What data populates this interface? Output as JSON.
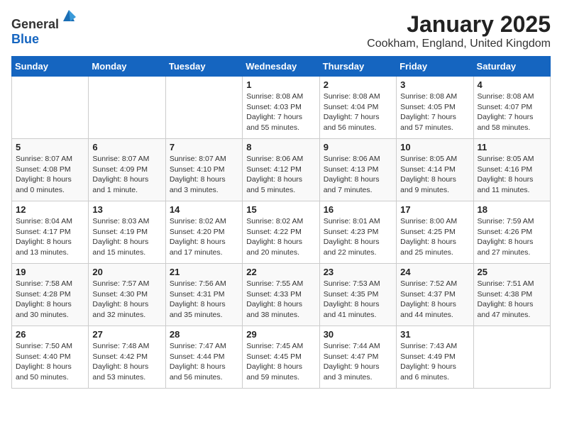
{
  "header": {
    "logo_general": "General",
    "logo_blue": "Blue",
    "title": "January 2025",
    "location": "Cookham, England, United Kingdom"
  },
  "days_of_week": [
    "Sunday",
    "Monday",
    "Tuesday",
    "Wednesday",
    "Thursday",
    "Friday",
    "Saturday"
  ],
  "weeks": [
    [
      {
        "day": "",
        "info": ""
      },
      {
        "day": "",
        "info": ""
      },
      {
        "day": "",
        "info": ""
      },
      {
        "day": "1",
        "info": "Sunrise: 8:08 AM\nSunset: 4:03 PM\nDaylight: 7 hours\nand 55 minutes."
      },
      {
        "day": "2",
        "info": "Sunrise: 8:08 AM\nSunset: 4:04 PM\nDaylight: 7 hours\nand 56 minutes."
      },
      {
        "day": "3",
        "info": "Sunrise: 8:08 AM\nSunset: 4:05 PM\nDaylight: 7 hours\nand 57 minutes."
      },
      {
        "day": "4",
        "info": "Sunrise: 8:08 AM\nSunset: 4:07 PM\nDaylight: 7 hours\nand 58 minutes."
      }
    ],
    [
      {
        "day": "5",
        "info": "Sunrise: 8:07 AM\nSunset: 4:08 PM\nDaylight: 8 hours\nand 0 minutes."
      },
      {
        "day": "6",
        "info": "Sunrise: 8:07 AM\nSunset: 4:09 PM\nDaylight: 8 hours\nand 1 minute."
      },
      {
        "day": "7",
        "info": "Sunrise: 8:07 AM\nSunset: 4:10 PM\nDaylight: 8 hours\nand 3 minutes."
      },
      {
        "day": "8",
        "info": "Sunrise: 8:06 AM\nSunset: 4:12 PM\nDaylight: 8 hours\nand 5 minutes."
      },
      {
        "day": "9",
        "info": "Sunrise: 8:06 AM\nSunset: 4:13 PM\nDaylight: 8 hours\nand 7 minutes."
      },
      {
        "day": "10",
        "info": "Sunrise: 8:05 AM\nSunset: 4:14 PM\nDaylight: 8 hours\nand 9 minutes."
      },
      {
        "day": "11",
        "info": "Sunrise: 8:05 AM\nSunset: 4:16 PM\nDaylight: 8 hours\nand 11 minutes."
      }
    ],
    [
      {
        "day": "12",
        "info": "Sunrise: 8:04 AM\nSunset: 4:17 PM\nDaylight: 8 hours\nand 13 minutes."
      },
      {
        "day": "13",
        "info": "Sunrise: 8:03 AM\nSunset: 4:19 PM\nDaylight: 8 hours\nand 15 minutes."
      },
      {
        "day": "14",
        "info": "Sunrise: 8:02 AM\nSunset: 4:20 PM\nDaylight: 8 hours\nand 17 minutes."
      },
      {
        "day": "15",
        "info": "Sunrise: 8:02 AM\nSunset: 4:22 PM\nDaylight: 8 hours\nand 20 minutes."
      },
      {
        "day": "16",
        "info": "Sunrise: 8:01 AM\nSunset: 4:23 PM\nDaylight: 8 hours\nand 22 minutes."
      },
      {
        "day": "17",
        "info": "Sunrise: 8:00 AM\nSunset: 4:25 PM\nDaylight: 8 hours\nand 25 minutes."
      },
      {
        "day": "18",
        "info": "Sunrise: 7:59 AM\nSunset: 4:26 PM\nDaylight: 8 hours\nand 27 minutes."
      }
    ],
    [
      {
        "day": "19",
        "info": "Sunrise: 7:58 AM\nSunset: 4:28 PM\nDaylight: 8 hours\nand 30 minutes."
      },
      {
        "day": "20",
        "info": "Sunrise: 7:57 AM\nSunset: 4:30 PM\nDaylight: 8 hours\nand 32 minutes."
      },
      {
        "day": "21",
        "info": "Sunrise: 7:56 AM\nSunset: 4:31 PM\nDaylight: 8 hours\nand 35 minutes."
      },
      {
        "day": "22",
        "info": "Sunrise: 7:55 AM\nSunset: 4:33 PM\nDaylight: 8 hours\nand 38 minutes."
      },
      {
        "day": "23",
        "info": "Sunrise: 7:53 AM\nSunset: 4:35 PM\nDaylight: 8 hours\nand 41 minutes."
      },
      {
        "day": "24",
        "info": "Sunrise: 7:52 AM\nSunset: 4:37 PM\nDaylight: 8 hours\nand 44 minutes."
      },
      {
        "day": "25",
        "info": "Sunrise: 7:51 AM\nSunset: 4:38 PM\nDaylight: 8 hours\nand 47 minutes."
      }
    ],
    [
      {
        "day": "26",
        "info": "Sunrise: 7:50 AM\nSunset: 4:40 PM\nDaylight: 8 hours\nand 50 minutes."
      },
      {
        "day": "27",
        "info": "Sunrise: 7:48 AM\nSunset: 4:42 PM\nDaylight: 8 hours\nand 53 minutes."
      },
      {
        "day": "28",
        "info": "Sunrise: 7:47 AM\nSunset: 4:44 PM\nDaylight: 8 hours\nand 56 minutes."
      },
      {
        "day": "29",
        "info": "Sunrise: 7:45 AM\nSunset: 4:45 PM\nDaylight: 8 hours\nand 59 minutes."
      },
      {
        "day": "30",
        "info": "Sunrise: 7:44 AM\nSunset: 4:47 PM\nDaylight: 9 hours\nand 3 minutes."
      },
      {
        "day": "31",
        "info": "Sunrise: 7:43 AM\nSunset: 4:49 PM\nDaylight: 9 hours\nand 6 minutes."
      },
      {
        "day": "",
        "info": ""
      }
    ]
  ]
}
